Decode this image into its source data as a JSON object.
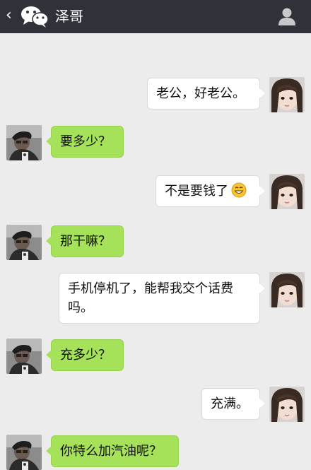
{
  "header": {
    "back_glyph": "‹",
    "app_icon": "wechat-logo-icon",
    "title": "泽哥",
    "profile_icon": "person-icon",
    "background": "#2f3238"
  },
  "chat": {
    "background": "#ececec",
    "messages": [
      {
        "sender": "me",
        "text": "老公，好老公。"
      },
      {
        "sender": "other",
        "text": "要多少？"
      },
      {
        "sender": "me",
        "text": "不是要钱了",
        "emoji": "grinning-face-emoji"
      },
      {
        "sender": "other",
        "text": "那干嘛？"
      },
      {
        "sender": "me",
        "text": "手机停机了，能帮我交个话费吗。"
      },
      {
        "sender": "other",
        "text": "充多少？"
      },
      {
        "sender": "me",
        "text": "充满。"
      },
      {
        "sender": "other",
        "text": "你特么加汽油呢？"
      }
    ]
  },
  "colors": {
    "me_bubble": "#ffffff",
    "other_bubble": "#a5e25a"
  }
}
